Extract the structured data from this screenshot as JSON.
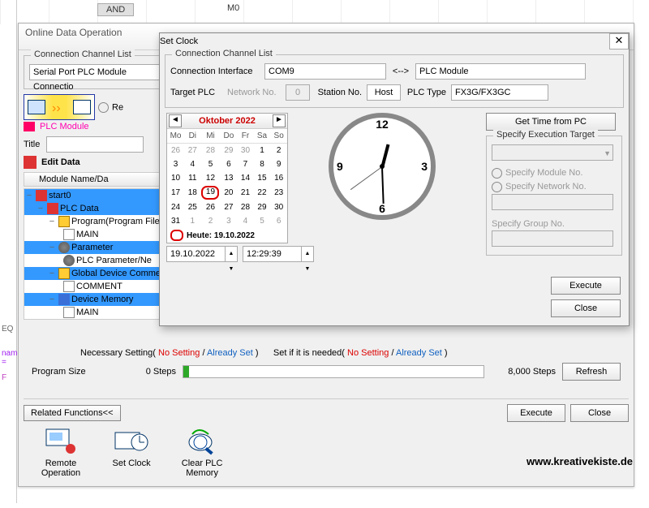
{
  "bg": {
    "and": "AND",
    "m0": "M0",
    "eq": "EQ",
    "name": "name =",
    "f": "F"
  },
  "mainwin": {
    "title": "Online Data Operation",
    "gp_conn": "Connection Channel List",
    "conn_field": "Serial Port  PLC Module Connectio",
    "re_radio": "Re",
    "plc_module": "PLC Module",
    "title_lbl": "Title",
    "edit_data": "Edit Data",
    "module_head": "Module Name/Da"
  },
  "tree": {
    "start0": "start0",
    "plc_data": "PLC Data",
    "program": "Program(Program File",
    "main1": "MAIN",
    "parameter": "Parameter",
    "plc_param": "PLC Parameter/Ne",
    "gdc": "Global Device Comme",
    "comment": "COMMENT",
    "dev_mem": "Device Memory",
    "main2": "MAIN"
  },
  "necessary": {
    "label": "Necessary Setting(",
    "no_setting": "No Setting",
    "slash": " / ",
    "already": "Already Set",
    "close": " )",
    "set_if": "Set if it is needed(",
    "prog_size": "Program Size",
    "steps_val": "0 Steps",
    "steps_max": "8,000 Steps",
    "refresh": "Refresh"
  },
  "related": {
    "label": "Related Functions<<",
    "execute": "Execute",
    "close": "Close",
    "remote": "Remote Operation",
    "setclock": "Set Clock",
    "clear": "Clear PLC Memory"
  },
  "dlg": {
    "title": "Set Clock",
    "gp": "Connection Channel List",
    "iface_lbl": "Connection Interface",
    "iface": "COM9",
    "arrow": "<-->",
    "plcmod": "PLC Module",
    "target": "Target PLC",
    "netno_lbl": "Network No.",
    "netno": "0",
    "stn_lbl": "Station No.",
    "stn": "Host",
    "plctype_lbl": "PLC Type",
    "plctype": "FX3G/FX3GC",
    "get_time": "Get Time from PC",
    "spec_target": "Specify Execution Target",
    "spec_mod": "Specify Module No.",
    "spec_net": "Specify Network No.",
    "spec_grp": "Specify Group No.",
    "execute": "Execute",
    "close": "Close",
    "date": "19.10.2022",
    "time": "12:29:39"
  },
  "cal": {
    "month": "Oktober 2022",
    "dows": [
      "Mo",
      "Di",
      "Mi",
      "Do",
      "Fr",
      "Sa",
      "So"
    ],
    "rows": [
      [
        {
          "n": 26,
          "o": 1
        },
        {
          "n": 27,
          "o": 1
        },
        {
          "n": 28,
          "o": 1
        },
        {
          "n": 29,
          "o": 1
        },
        {
          "n": 30,
          "o": 1
        },
        {
          "n": 1
        },
        {
          "n": 2
        }
      ],
      [
        {
          "n": 3
        },
        {
          "n": 4
        },
        {
          "n": 5
        },
        {
          "n": 6
        },
        {
          "n": 7
        },
        {
          "n": 8
        },
        {
          "n": 9
        }
      ],
      [
        {
          "n": 10
        },
        {
          "n": 11
        },
        {
          "n": 12
        },
        {
          "n": 13
        },
        {
          "n": 14
        },
        {
          "n": 15
        },
        {
          "n": 16
        }
      ],
      [
        {
          "n": 17
        },
        {
          "n": 18
        },
        {
          "n": 19,
          "t": 1
        },
        {
          "n": 20
        },
        {
          "n": 21
        },
        {
          "n": 22
        },
        {
          "n": 23
        }
      ],
      [
        {
          "n": 24
        },
        {
          "n": 25
        },
        {
          "n": 26
        },
        {
          "n": 27
        },
        {
          "n": 28
        },
        {
          "n": 29
        },
        {
          "n": 30
        }
      ],
      [
        {
          "n": 31
        },
        {
          "n": 1,
          "o": 1
        },
        {
          "n": 2,
          "o": 1
        },
        {
          "n": 3,
          "o": 1
        },
        {
          "n": 4,
          "o": 1
        },
        {
          "n": 5,
          "o": 1
        },
        {
          "n": 6,
          "o": 1
        }
      ]
    ],
    "today_prefix": "Heute: ",
    "today": "19.10.2022"
  },
  "clock": {
    "h": 12,
    "m": 29,
    "s": 39
  },
  "watermark": "www.kreativekiste.de"
}
